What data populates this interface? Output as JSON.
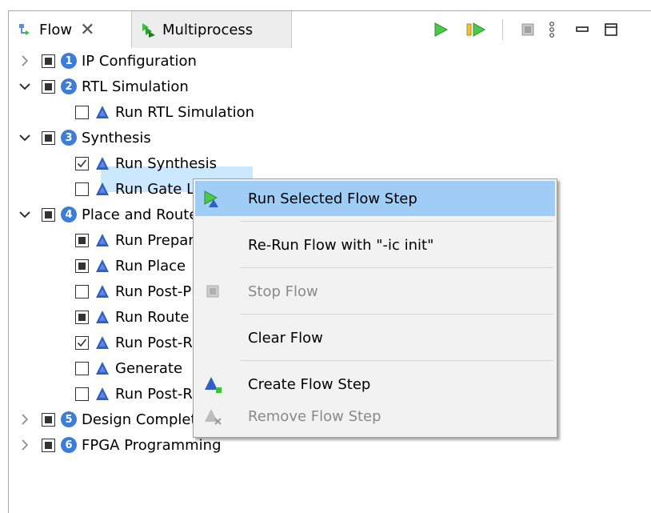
{
  "tabs": [
    {
      "label": "Flow",
      "active": true,
      "icon": "flow-icon"
    },
    {
      "label": "Multiprocess",
      "active": false,
      "icon": "multiprocess-icon"
    }
  ],
  "toolbar": {
    "icons": [
      "run-icon",
      "run-from-icon",
      "stop-icon",
      "view-menu-icon",
      "minimize-icon",
      "maximize-icon"
    ]
  },
  "tree": [
    {
      "label": "IP Configuration",
      "num": "1",
      "expanded": false,
      "check": "partial"
    },
    {
      "label": "RTL Simulation",
      "num": "2",
      "expanded": true,
      "check": "partial"
    },
    {
      "label": "Run RTL Simulation",
      "check": "none"
    },
    {
      "label": "Synthesis",
      "num": "3",
      "expanded": true,
      "check": "partial"
    },
    {
      "label": "Run Synthesis",
      "check": "checked",
      "selected": true
    },
    {
      "label": "Run Gate Level Simulation",
      "check": "none"
    },
    {
      "label": "Place and Route",
      "num": "4",
      "expanded": true,
      "check": "partial"
    },
    {
      "label": "Run Prepare",
      "check": "partial"
    },
    {
      "label": "Run Place",
      "check": "partial"
    },
    {
      "label": "Run Post-Place",
      "check": "none"
    },
    {
      "label": "Run Route",
      "check": "partial"
    },
    {
      "label": "Run Post-Route",
      "check": "checked"
    },
    {
      "label": "Generate",
      "check": "none"
    },
    {
      "label": "Run Post-Route Netlist Simulation",
      "check": "none"
    },
    {
      "label": "Design Completion",
      "num": "5",
      "expanded": false,
      "check": "partial"
    },
    {
      "label": "FPGA Programming",
      "num": "6",
      "expanded": false,
      "check": "partial"
    }
  ],
  "context_menu": {
    "items": [
      {
        "label": "Run Selected Flow Step",
        "icon": "run-step-icon",
        "highlighted": true,
        "disabled": false
      },
      {
        "label": "Re-Run Flow with \"-ic init\"",
        "icon": "",
        "disabled": false
      },
      {
        "label": "Stop Flow",
        "icon": "stop-icon",
        "disabled": true
      },
      {
        "label": "Clear Flow",
        "icon": "",
        "disabled": false
      },
      {
        "label": "Create Flow Step",
        "icon": "create-step-icon",
        "disabled": false
      },
      {
        "label": "Remove Flow Step",
        "icon": "remove-step-icon",
        "disabled": true
      }
    ]
  },
  "colors": {
    "accent": "#3b7dd8",
    "selection": "#cce8ff",
    "menu_highlight": "#9fcdf5",
    "run_green": "#3fbf3f"
  }
}
